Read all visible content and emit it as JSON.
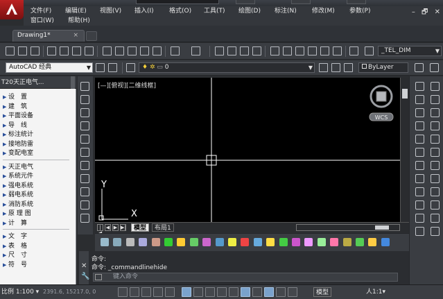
{
  "app": {
    "menu_row1": [
      "文件(F)",
      "编辑(E)",
      "视图(V)",
      "插入(I)",
      "格式(O)",
      "工具(T)",
      "绘图(D)",
      "标注(N)",
      "修改(M)",
      "参数(P)"
    ],
    "menu_row2": [
      "窗口(W)",
      "帮助(H)"
    ],
    "window_controls": [
      "–",
      "🗗",
      "✕"
    ],
    "colors": {
      "chrome": "#3a3d42",
      "canvas": "#000000",
      "panel": "#f4f4f4",
      "accent": "#7aa2cc",
      "logo": "#b22222"
    }
  },
  "document": {
    "tab_label": "Drawing1*",
    "tab_close": "×"
  },
  "toolbar1": {
    "textstyle_combo": "_TEL_DIM"
  },
  "toolbar2": {
    "workspace_combo": "AutoCAD 经典",
    "layer_combo": "0",
    "linetype_combo": "ByLayer"
  },
  "tianzheng_panel": {
    "title": "T20天正电气...",
    "group1": [
      "设　置",
      "建　筑",
      "平面设备",
      "导　线",
      "标注统计",
      "接地防雷",
      "变配电室"
    ],
    "group2": [
      "天正电气",
      "系统元件",
      "强电系统",
      "弱电系统",
      "消防系统",
      "原 理 图",
      "计　算"
    ],
    "group3": [
      "文　字",
      "表　格",
      "尺　寸",
      "符　号"
    ]
  },
  "canvas": {
    "viewport_label": "[—][俯视][二维线框]",
    "ucs_y": "Y",
    "ucs_x": "X",
    "wcs_label": "WCS"
  },
  "layout_tabs": [
    "模型",
    "布局1"
  ],
  "command": {
    "history": [
      {
        "prefix": "命令:",
        "text": ""
      },
      {
        "prefix": "命令:",
        "text": " _commandlinehide"
      }
    ],
    "placeholder": "键入命令"
  },
  "statusbar": {
    "scale": "比例 1:100 ▾",
    "coords": "2391.6, 15217.0, 0",
    "model_label": "模型",
    "anno_scale": "人1:1▾"
  }
}
